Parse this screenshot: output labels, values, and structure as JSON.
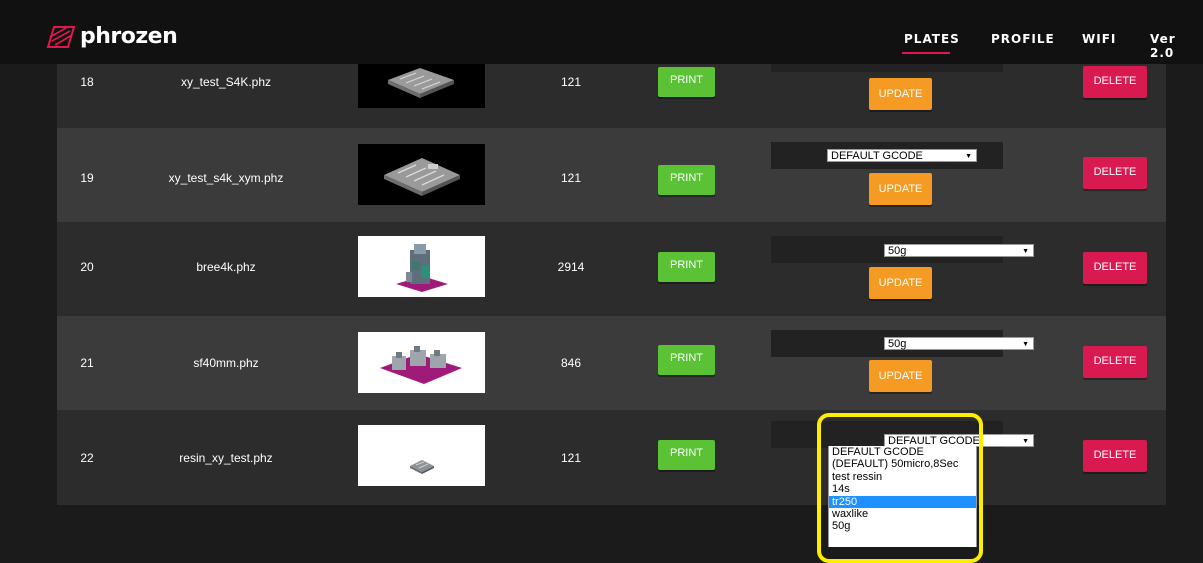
{
  "header": {
    "brand": "phrozen",
    "nav": [
      {
        "label": "PLATES",
        "active": true
      },
      {
        "label": "PROFILE",
        "active": false
      },
      {
        "label": "WIFI",
        "active": false
      }
    ],
    "version": "Ver 2.0"
  },
  "colors": {
    "accent": "#e0174f",
    "print": "#5bc236",
    "update": "#f59a22",
    "delete": "#d81a51",
    "dropdown_selected": "#1e90ff",
    "highlight": "#ffed00"
  },
  "plates": [
    {
      "index": "18",
      "name": "xy_test_S4K.phz",
      "layers": "121",
      "print_label": "PRINT",
      "update_label": "UPDATE",
      "delete_label": "DELETE",
      "gcode": ""
    },
    {
      "index": "19",
      "name": "xy_test_s4k_xym.phz",
      "layers": "121",
      "print_label": "PRINT",
      "update_label": "UPDATE",
      "delete_label": "DELETE",
      "gcode": "DEFAULT GCODE"
    },
    {
      "index": "20",
      "name": "bree4k.phz",
      "layers": "2914",
      "print_label": "PRINT",
      "update_label": "UPDATE",
      "delete_label": "DELETE",
      "gcode": "50g"
    },
    {
      "index": "21",
      "name": "sf40mm.phz",
      "layers": "846",
      "print_label": "PRINT",
      "update_label": "UPDATE",
      "delete_label": "DELETE",
      "gcode": "50g"
    },
    {
      "index": "22",
      "name": "resin_xy_test.phz",
      "layers": "121",
      "print_label": "PRINT",
      "update_label": "UPDATE",
      "delete_label": "DELETE",
      "gcode": "DEFAULT GCODE"
    }
  ],
  "dropdown": {
    "options": [
      "DEFAULT GCODE",
      "(DEFAULT) 50micro,8Sec",
      "test ressin",
      "14s",
      "tr250",
      "waxlike",
      "50g"
    ],
    "highlighted": "tr250"
  }
}
